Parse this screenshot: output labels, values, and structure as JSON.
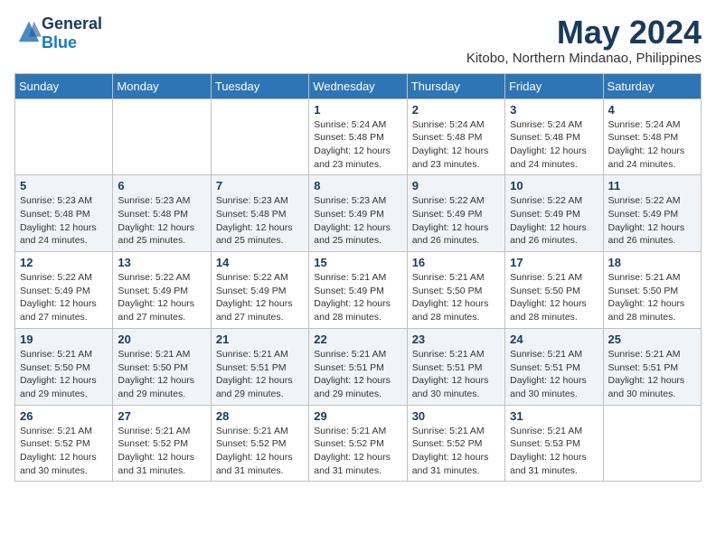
{
  "logo": {
    "general": "General",
    "blue": "Blue"
  },
  "title": {
    "month": "May 2024",
    "location": "Kitobo, Northern Mindanao, Philippines"
  },
  "weekdays": [
    "Sunday",
    "Monday",
    "Tuesday",
    "Wednesday",
    "Thursday",
    "Friday",
    "Saturday"
  ],
  "weeks": [
    [
      {
        "day": "",
        "info": ""
      },
      {
        "day": "",
        "info": ""
      },
      {
        "day": "",
        "info": ""
      },
      {
        "day": "1",
        "info": "Sunrise: 5:24 AM\nSunset: 5:48 PM\nDaylight: 12 hours\nand 23 minutes."
      },
      {
        "day": "2",
        "info": "Sunrise: 5:24 AM\nSunset: 5:48 PM\nDaylight: 12 hours\nand 23 minutes."
      },
      {
        "day": "3",
        "info": "Sunrise: 5:24 AM\nSunset: 5:48 PM\nDaylight: 12 hours\nand 24 minutes."
      },
      {
        "day": "4",
        "info": "Sunrise: 5:24 AM\nSunset: 5:48 PM\nDaylight: 12 hours\nand 24 minutes."
      }
    ],
    [
      {
        "day": "5",
        "info": "Sunrise: 5:23 AM\nSunset: 5:48 PM\nDaylight: 12 hours\nand 24 minutes."
      },
      {
        "day": "6",
        "info": "Sunrise: 5:23 AM\nSunset: 5:48 PM\nDaylight: 12 hours\nand 25 minutes."
      },
      {
        "day": "7",
        "info": "Sunrise: 5:23 AM\nSunset: 5:48 PM\nDaylight: 12 hours\nand 25 minutes."
      },
      {
        "day": "8",
        "info": "Sunrise: 5:23 AM\nSunset: 5:49 PM\nDaylight: 12 hours\nand 25 minutes."
      },
      {
        "day": "9",
        "info": "Sunrise: 5:22 AM\nSunset: 5:49 PM\nDaylight: 12 hours\nand 26 minutes."
      },
      {
        "day": "10",
        "info": "Sunrise: 5:22 AM\nSunset: 5:49 PM\nDaylight: 12 hours\nand 26 minutes."
      },
      {
        "day": "11",
        "info": "Sunrise: 5:22 AM\nSunset: 5:49 PM\nDaylight: 12 hours\nand 26 minutes."
      }
    ],
    [
      {
        "day": "12",
        "info": "Sunrise: 5:22 AM\nSunset: 5:49 PM\nDaylight: 12 hours\nand 27 minutes."
      },
      {
        "day": "13",
        "info": "Sunrise: 5:22 AM\nSunset: 5:49 PM\nDaylight: 12 hours\nand 27 minutes."
      },
      {
        "day": "14",
        "info": "Sunrise: 5:22 AM\nSunset: 5:49 PM\nDaylight: 12 hours\nand 27 minutes."
      },
      {
        "day": "15",
        "info": "Sunrise: 5:21 AM\nSunset: 5:49 PM\nDaylight: 12 hours\nand 28 minutes."
      },
      {
        "day": "16",
        "info": "Sunrise: 5:21 AM\nSunset: 5:50 PM\nDaylight: 12 hours\nand 28 minutes."
      },
      {
        "day": "17",
        "info": "Sunrise: 5:21 AM\nSunset: 5:50 PM\nDaylight: 12 hours\nand 28 minutes."
      },
      {
        "day": "18",
        "info": "Sunrise: 5:21 AM\nSunset: 5:50 PM\nDaylight: 12 hours\nand 28 minutes."
      }
    ],
    [
      {
        "day": "19",
        "info": "Sunrise: 5:21 AM\nSunset: 5:50 PM\nDaylight: 12 hours\nand 29 minutes."
      },
      {
        "day": "20",
        "info": "Sunrise: 5:21 AM\nSunset: 5:50 PM\nDaylight: 12 hours\nand 29 minutes."
      },
      {
        "day": "21",
        "info": "Sunrise: 5:21 AM\nSunset: 5:51 PM\nDaylight: 12 hours\nand 29 minutes."
      },
      {
        "day": "22",
        "info": "Sunrise: 5:21 AM\nSunset: 5:51 PM\nDaylight: 12 hours\nand 29 minutes."
      },
      {
        "day": "23",
        "info": "Sunrise: 5:21 AM\nSunset: 5:51 PM\nDaylight: 12 hours\nand 30 minutes."
      },
      {
        "day": "24",
        "info": "Sunrise: 5:21 AM\nSunset: 5:51 PM\nDaylight: 12 hours\nand 30 minutes."
      },
      {
        "day": "25",
        "info": "Sunrise: 5:21 AM\nSunset: 5:51 PM\nDaylight: 12 hours\nand 30 minutes."
      }
    ],
    [
      {
        "day": "26",
        "info": "Sunrise: 5:21 AM\nSunset: 5:52 PM\nDaylight: 12 hours\nand 30 minutes."
      },
      {
        "day": "27",
        "info": "Sunrise: 5:21 AM\nSunset: 5:52 PM\nDaylight: 12 hours\nand 31 minutes."
      },
      {
        "day": "28",
        "info": "Sunrise: 5:21 AM\nSunset: 5:52 PM\nDaylight: 12 hours\nand 31 minutes."
      },
      {
        "day": "29",
        "info": "Sunrise: 5:21 AM\nSunset: 5:52 PM\nDaylight: 12 hours\nand 31 minutes."
      },
      {
        "day": "30",
        "info": "Sunrise: 5:21 AM\nSunset: 5:52 PM\nDaylight: 12 hours\nand 31 minutes."
      },
      {
        "day": "31",
        "info": "Sunrise: 5:21 AM\nSunset: 5:53 PM\nDaylight: 12 hours\nand 31 minutes."
      },
      {
        "day": "",
        "info": ""
      }
    ]
  ]
}
